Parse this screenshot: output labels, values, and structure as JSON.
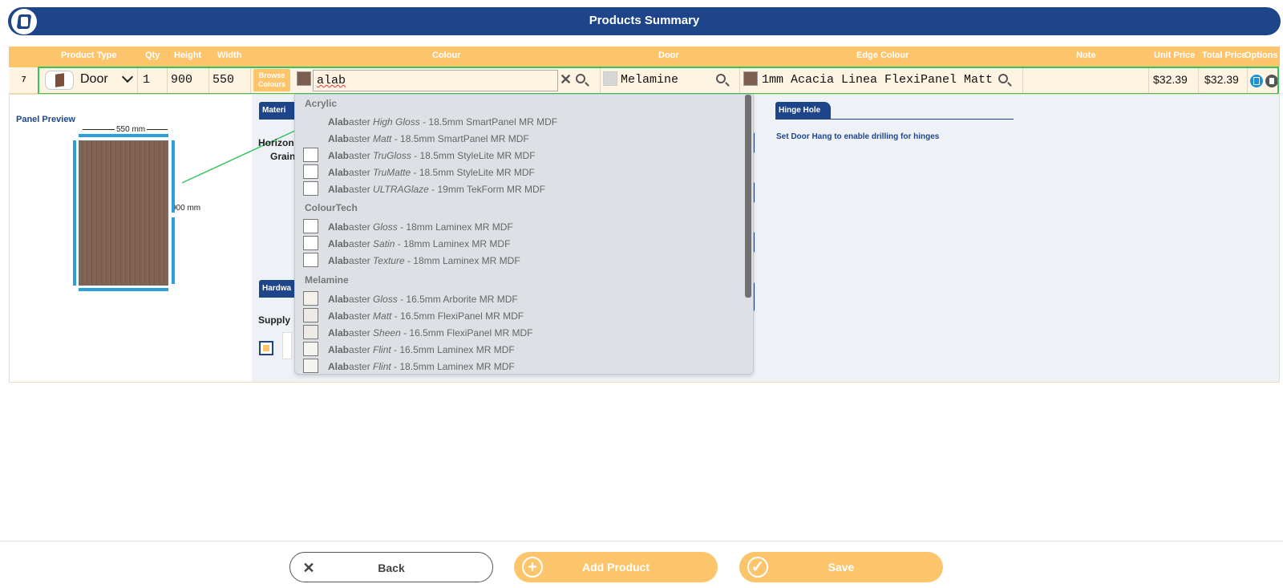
{
  "header": {
    "title": "Products Summary"
  },
  "table": {
    "columns": [
      "Product Type",
      "Qty",
      "Height",
      "Width",
      "Colour",
      "Door",
      "Edge Colour",
      "Note",
      "Unit Price",
      "Total Price",
      "Options"
    ],
    "row": {
      "number": "7",
      "product_type": "Door",
      "qty": "1",
      "height": "900",
      "width": "550",
      "browse_label_1": "Browse",
      "browse_label_2": "Colours",
      "colour_query": "alab",
      "door": "Melamine",
      "edge_colour": "1mm Acacia Linea FlexiPanel Matt",
      "note": "",
      "unit_price": "$32.39",
      "total_price": "$32.39"
    }
  },
  "preview": {
    "title": "Panel Preview",
    "width_label": "550 mm",
    "height_label": "900 mm"
  },
  "sections": {
    "material_tab": "Materi",
    "grain_label_1": "Horizon",
    "grain_label_2": "Grain:",
    "hardware_tab": "Hardwa",
    "supply_label": "Supply",
    "hinge_tab": "Hinge Hole",
    "hinge_message": "Set Door Hang to enable drilling for hinges"
  },
  "dropdown": {
    "groups": [
      {
        "name": "Acrylic",
        "items": [
          {
            "bold": "Alab",
            "rest": "aster",
            "finish": "High Gloss",
            "desc": " - 18.5mm SmartPanel MR MDF",
            "swatch": ""
          },
          {
            "bold": "Alab",
            "rest": "aster",
            "finish": "Matt",
            "desc": " - 18.5mm SmartPanel MR MDF",
            "swatch": ""
          },
          {
            "bold": "Alab",
            "rest": "aster",
            "finish": "TruGloss",
            "desc": " - 18.5mm StyleLite MR MDF",
            "swatch": "#ffffff"
          },
          {
            "bold": "Alab",
            "rest": "aster",
            "finish": "TruMatte",
            "desc": " - 18.5mm StyleLite MR MDF",
            "swatch": "#ffffff"
          },
          {
            "bold": "Alab",
            "rest": "aster",
            "finish": "ULTRAGlaze",
            "desc": " - 19mm TekForm MR MDF",
            "swatch": "#ffffff"
          }
        ]
      },
      {
        "name": "ColourTech",
        "items": [
          {
            "bold": "Alab",
            "rest": "aster",
            "finish": "Gloss",
            "desc": " - 18mm Laminex MR MDF",
            "swatch": "#ffffff"
          },
          {
            "bold": "Alab",
            "rest": "aster",
            "finish": "Satin",
            "desc": " - 18mm Laminex MR MDF",
            "swatch": "#ffffff"
          },
          {
            "bold": "Alab",
            "rest": "aster",
            "finish": "Texture",
            "desc": " - 18mm Laminex MR MDF",
            "swatch": "#ffffff"
          }
        ]
      },
      {
        "name": "Melamine",
        "items": [
          {
            "bold": "Alab",
            "rest": "aster",
            "finish": "Gloss",
            "desc": " - 16.5mm Arborite MR MDF",
            "swatch": "#f4f1ea"
          },
          {
            "bold": "Alab",
            "rest": "aster",
            "finish": "Matt",
            "desc": " - 16.5mm FlexiPanel MR MDF",
            "swatch": "#eeebe6"
          },
          {
            "bold": "Alab",
            "rest": "aster",
            "finish": "Sheen",
            "desc": " - 16.5mm FlexiPanel MR MDF",
            "swatch": "#eeebe6"
          },
          {
            "bold": "Alab",
            "rest": "aster",
            "finish": "Flint",
            "desc": " - 16.5mm Laminex MR MDF",
            "swatch": "#f6f4ef"
          },
          {
            "bold": "Alab",
            "rest": "aster",
            "finish": "Flint",
            "desc": " - 18.5mm Laminex MR MDF",
            "swatch": "#f6f4ef"
          }
        ]
      }
    ]
  },
  "footer": {
    "back_label": "Back",
    "add_label": "Add Product",
    "save_label": "Save"
  },
  "colors": {
    "brand_navy": "#1e4589",
    "accent_orange": "#fcc56c",
    "highlight_green": "#36c25f",
    "edge_blue": "#2b9fde",
    "wood_brown": "#7b5e4d"
  }
}
